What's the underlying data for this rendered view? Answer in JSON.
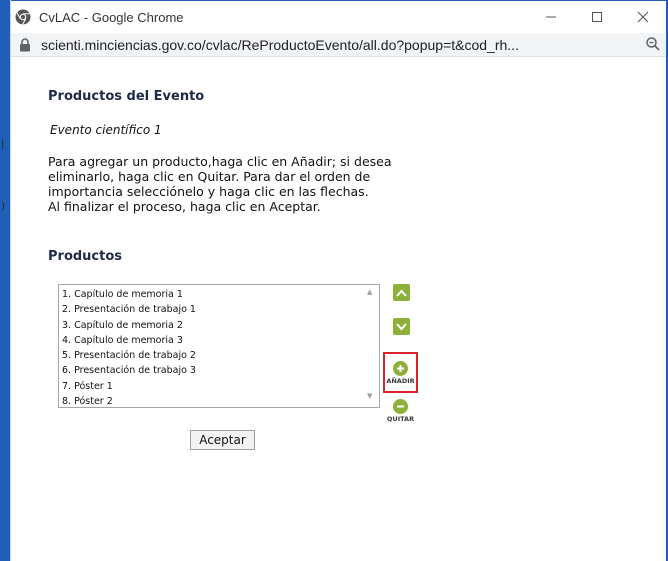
{
  "window": {
    "title": "CvLAC - Google Chrome",
    "url": "scienti.minciencias.gov.co/cvlac/ReProductoEvento/all.do?popup=t&cod_rh..."
  },
  "page": {
    "title": "Productos del Evento",
    "event_name": "Evento científico 1",
    "instructions": [
      "Para agregar un producto,haga clic en Añadir; si desea",
      "eliminarlo, haga clic en Quitar. Para dar el orden de",
      "importancia selecciónelo y haga clic en las flechas.",
      "Al finalizar el proceso, haga clic en Aceptar."
    ],
    "products_heading": "Productos",
    "products": [
      "1. Capítulo de memoria 1",
      "2. Presentación de trabajo 1",
      "3. Capítulo de memoria 2",
      "4. Capítulo de memoria 3",
      "5. Presentación de trabajo 2",
      "6. Presentación de trabajo 3",
      "7. Póster 1",
      "8. Póster 2"
    ],
    "add_label": "AÑADIR",
    "remove_label": "QUITAR",
    "accept_label": "Aceptar"
  },
  "colors": {
    "accent_green": "#8db03a",
    "highlight_red": "#d9232b",
    "window_border": "#1f5fb8"
  },
  "icons": [
    "chrome-icon",
    "minimize-icon",
    "maximize-icon",
    "close-icon",
    "lock-icon",
    "zoom-icon",
    "arrow-up-icon",
    "arrow-down-icon",
    "plus-icon",
    "minus-icon"
  ]
}
